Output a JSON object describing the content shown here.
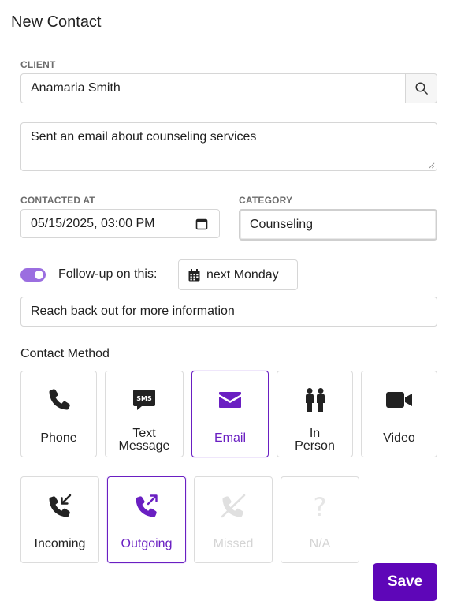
{
  "form": {
    "title": "New Contact",
    "client": {
      "label": "CLIENT",
      "value": "Anamaria Smith"
    },
    "note": {
      "value": "Sent an email about counseling services"
    },
    "contacted_at": {
      "label": "CONTACTED AT",
      "value": "05/15/2025, 03:00 PM"
    },
    "category": {
      "label": "CATEGORY",
      "value": "Counseling"
    },
    "follow_up": {
      "enabled": true,
      "label": "Follow-up on this:",
      "when": "next Monday",
      "note": "Reach back out for more information"
    },
    "contact_method": {
      "label": "Contact Method",
      "selected": "Email",
      "options": [
        {
          "line1": "Phone",
          "line2": "",
          "icon": "phone-icon"
        },
        {
          "line1": "Text",
          "line2": "Message",
          "icon": "sms-icon"
        },
        {
          "line1": "Email",
          "line2": "",
          "icon": "envelope-icon"
        },
        {
          "line1": "In",
          "line2": "Person",
          "icon": "people-icon"
        },
        {
          "line1": "Video",
          "line2": "",
          "icon": "video-camera-icon"
        }
      ]
    },
    "direction": {
      "selected": "Outgoing",
      "options": [
        {
          "label": "Incoming",
          "icon": "incoming-call-icon",
          "disabled": false
        },
        {
          "label": "Outgoing",
          "icon": "outgoing-call-icon",
          "disabled": false
        },
        {
          "label": "Missed",
          "icon": "missed-call-icon",
          "disabled": true
        },
        {
          "label": "N/A",
          "icon": "question-mark-icon",
          "disabled": true
        }
      ]
    },
    "save_label": "Save"
  },
  "colors": {
    "accent": "#6a1fc2",
    "save_bg": "#5e06b8",
    "toggle": "#9b6ee0",
    "border": "#d6d6d6"
  }
}
